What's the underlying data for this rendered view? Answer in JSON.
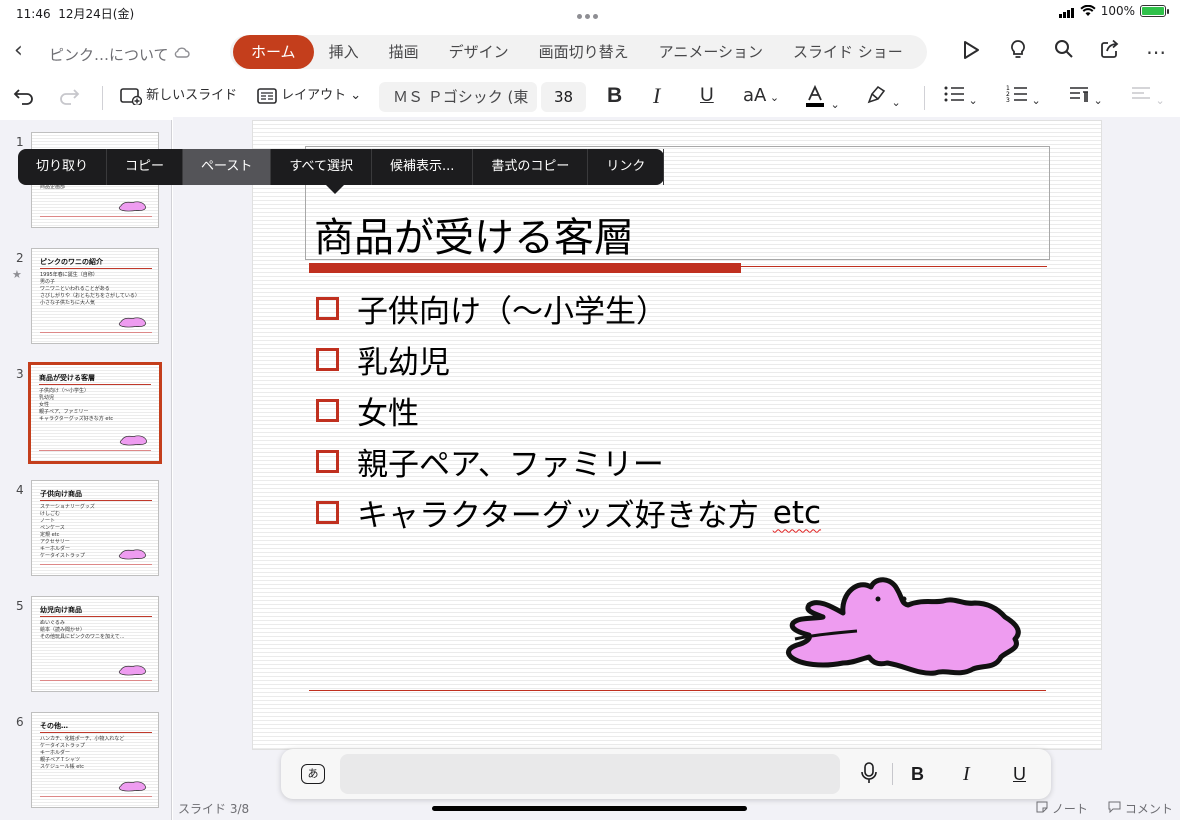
{
  "status_bar": {
    "time": "11:46",
    "date": "12月24日(金)",
    "battery": "100%"
  },
  "header": {
    "doc_title": "ピンク…について",
    "tabs": [
      {
        "label": "ホーム",
        "active": true
      },
      {
        "label": "挿入",
        "active": false
      },
      {
        "label": "描画",
        "active": false
      },
      {
        "label": "デザイン",
        "active": false
      },
      {
        "label": "画面切り替え",
        "active": false
      },
      {
        "label": "アニメーション",
        "active": false
      },
      {
        "label": "スライド ショー",
        "active": false
      }
    ],
    "icons": [
      "play-icon",
      "lightbulb-icon",
      "search-icon",
      "share-icon",
      "more-icon"
    ]
  },
  "toolbar": {
    "new_slide": "新しいスライド",
    "layout": "レイアウト",
    "font_name": "ＭＳ Ｐゴシック (東",
    "font_size": "38",
    "bold": "B",
    "italic": "I",
    "underline": "U",
    "font_size_aa": "aA"
  },
  "context_menu": {
    "items": [
      {
        "label": "切り取り",
        "highlight": false
      },
      {
        "label": "コピー",
        "highlight": false
      },
      {
        "label": "ペースト",
        "highlight": true
      },
      {
        "label": "すべて選択",
        "highlight": false
      },
      {
        "label": "候補表示...",
        "highlight": false
      },
      {
        "label": "書式のコピー",
        "highlight": false
      },
      {
        "label": "リンク",
        "highlight": false
      }
    ]
  },
  "thumbnails": [
    {
      "num": "1",
      "title": "",
      "lines": [
        "クロコダイルワールド株式会社",
        "商品企画部"
      ],
      "star": false,
      "selected": false
    },
    {
      "num": "2",
      "title": "ピンクのワニの紹介",
      "lines": [
        "1995年春に誕生（自称）",
        "男の子",
        "ワニワニといわれることがある",
        "さびしがりや（おともだちをさがしている）",
        "小さな子供たちに大人気"
      ],
      "star": true,
      "selected": false
    },
    {
      "num": "3",
      "title": "商品が受ける客層",
      "lines": [
        "子供向け（～小学生）",
        "乳幼児",
        "女性",
        "親子ペア、ファミリー",
        "キャラクターグッズ好きな方 etc"
      ],
      "star": false,
      "selected": true
    },
    {
      "num": "4",
      "title": "子供向け商品",
      "lines": [
        "ステーショナリーグッズ",
        "けしごむ",
        "ノート",
        "ペンケース",
        "定規 etc",
        "アクセサリー",
        "キーホルダー",
        "ケータイストラップ"
      ],
      "star": false,
      "selected": false
    },
    {
      "num": "5",
      "title": "幼児向け商品",
      "lines": [
        "ぬいぐるみ",
        "絵本（読み聞かせ）",
        "その他玩具にピンクのワニを加えて..."
      ],
      "star": false,
      "selected": false
    },
    {
      "num": "6",
      "title": "その他…",
      "lines": [
        "ハンカチ、化粧ポーチ、小物入れなど",
        "ケータイストラップ",
        "キーホルダー",
        "親子ペアＴシャツ",
        "スケジュール帳 etc"
      ],
      "star": false,
      "selected": false
    }
  ],
  "slide": {
    "title": "商品が受ける客層",
    "bullets": [
      "子供向け（～小学生）",
      "乳幼児",
      "女性",
      "親子ペア、ファミリー",
      "キャラクターグッズ好きな方"
    ],
    "last_bullet_suffix": "etc",
    "accent_color": "#c0301f",
    "character_color": "#ee9cf0"
  },
  "keyboard_bar": {
    "kana": "あ",
    "bold": "B",
    "italic": "I",
    "underline": "U"
  },
  "footer": {
    "slide_count": "スライド 3/8",
    "notes": "ノート",
    "comments": "コメント"
  }
}
